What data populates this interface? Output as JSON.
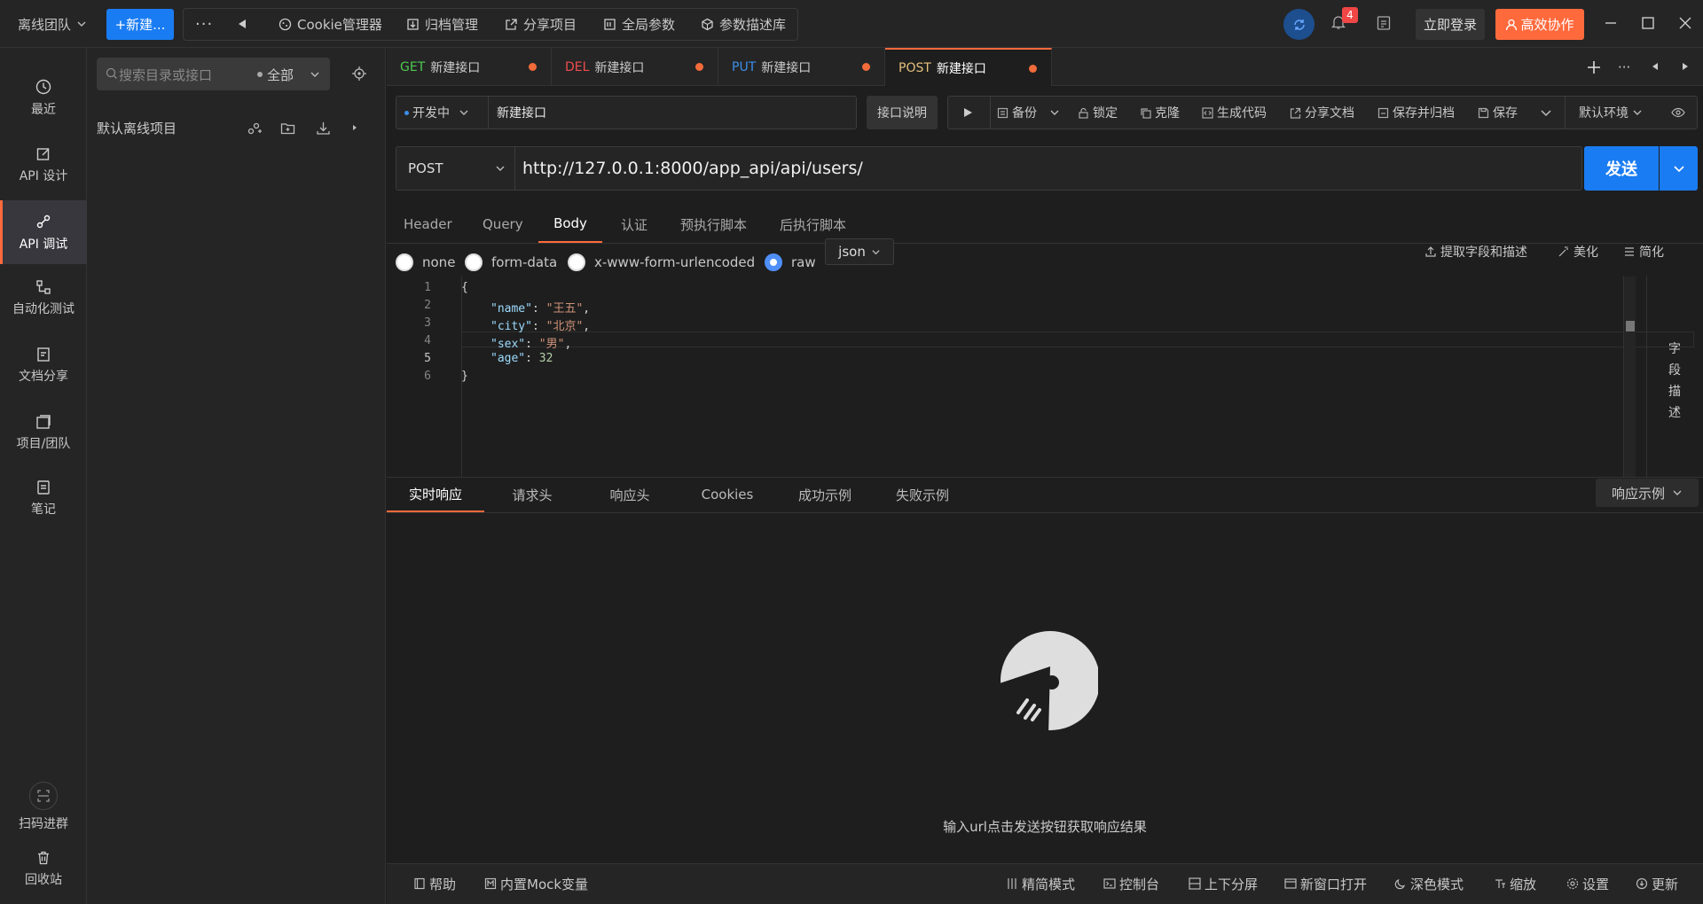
{
  "topbar": {
    "team": "离线团队",
    "new_button": "+新建...",
    "more": "···",
    "items": [
      "Cookie管理器",
      "归档管理",
      "分享项目",
      "全局参数",
      "参数描述库"
    ],
    "badge": "4",
    "login": "立即登录",
    "collab": "高效协作"
  },
  "nav": [
    {
      "label": "最近",
      "icon": "history-icon"
    },
    {
      "label": "API 设计",
      "icon": "edit-icon"
    },
    {
      "label": "API 调试",
      "icon": "link-icon"
    },
    {
      "label": "自动化测试",
      "icon": "flow-icon"
    },
    {
      "label": "文档分享",
      "icon": "doc-icon"
    },
    {
      "label": "项目/团队",
      "icon": "project-icon"
    },
    {
      "label": "笔记",
      "icon": "note-icon"
    }
  ],
  "nav_bottom": [
    {
      "label": "扫码进群"
    },
    {
      "label": "回收站"
    }
  ],
  "tree": {
    "search_placeholder": "搜索目录或接口",
    "filter": "全部",
    "project": "默认离线项目"
  },
  "tabs": [
    {
      "method": "GET",
      "name": "新建接口",
      "color": "#4ec94e"
    },
    {
      "method": "DEL",
      "name": "新建接口",
      "color": "#f14c4c"
    },
    {
      "method": "PUT",
      "name": "新建接口",
      "color": "#3b8eea"
    },
    {
      "method": "POST",
      "name": "新建接口",
      "color": "#e5c07b"
    }
  ],
  "request": {
    "status": "开发中",
    "name": "新建接口",
    "desc_btn": "接口说明",
    "tools": [
      "备份",
      "锁定",
      "克隆",
      "生成代码",
      "分享文档",
      "保存并归档",
      "保存"
    ],
    "env": "默认环境",
    "method": "POST",
    "url": "http://127.0.0.1:8000/app_api/api/users/",
    "send": "发送"
  },
  "subtabs": [
    "Header",
    "Query",
    "Body",
    "认证",
    "预执行脚本",
    "后执行脚本"
  ],
  "body": {
    "modes": [
      "none",
      "form-data",
      "x-www-form-urlencoded",
      "raw"
    ],
    "format": "json",
    "actions": [
      "提取字段和描述",
      "美化",
      "简化"
    ],
    "side_label": [
      "字",
      "段",
      "描",
      "述"
    ]
  },
  "code_lines": [
    {
      "n": "1",
      "t": "{"
    },
    {
      "n": "2",
      "k": "\"name\"",
      "v": "\"王五\"",
      "type": "s",
      "tail": ","
    },
    {
      "n": "3",
      "k": "\"city\"",
      "v": "\"北京\"",
      "type": "s",
      "tail": ","
    },
    {
      "n": "4",
      "k": "\"sex\"",
      "v": "\"男\"",
      "type": "s",
      "tail": ","
    },
    {
      "n": "5",
      "k": "\"age\"",
      "v": "32",
      "type": "n",
      "tail": ""
    },
    {
      "n": "6",
      "t": "}"
    }
  ],
  "response": {
    "tabs": [
      "实时响应",
      "请求头",
      "响应头",
      "Cookies",
      "成功示例",
      "失败示例"
    ],
    "example_btn": "响应示例",
    "empty_text": "输入url点击发送按钮获取响应结果"
  },
  "statusbar": {
    "left": [
      "帮助",
      "内置Mock变量"
    ],
    "right": [
      "精简模式",
      "控制台",
      "上下分屏",
      "新窗口打开",
      "深色模式",
      "缩放",
      "设置",
      "更新"
    ]
  },
  "colors": {
    "accent": "#ff6a3d",
    "send": "#1a7cf2",
    "new": "#1a7cf2"
  }
}
